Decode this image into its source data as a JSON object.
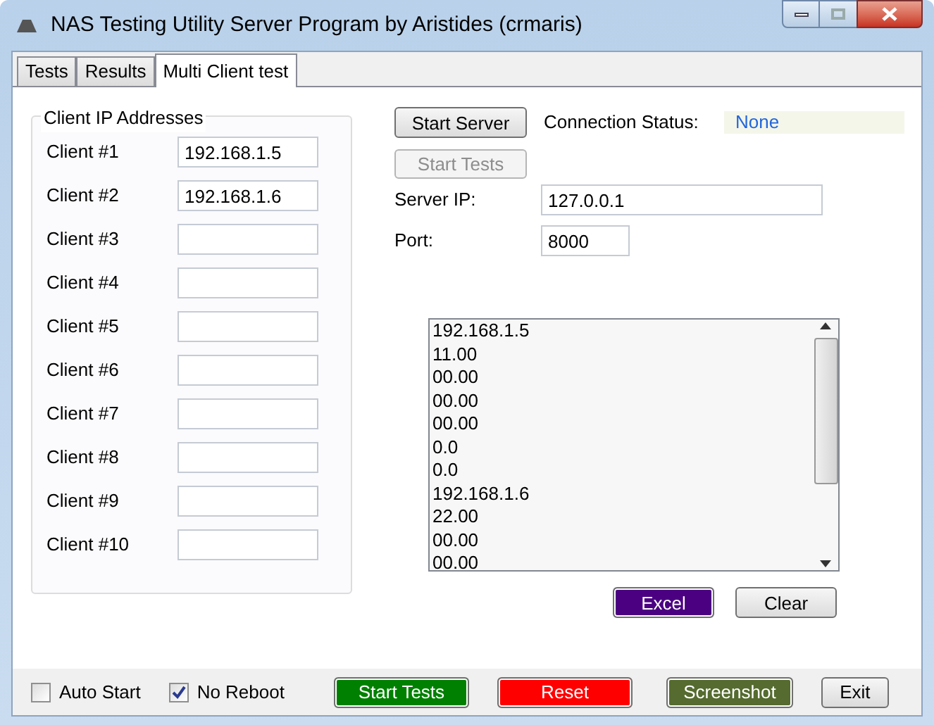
{
  "window": {
    "title": "NAS Testing Utility Server Program by Aristides (crmaris)"
  },
  "tabs": [
    {
      "label": "Tests",
      "selected": false
    },
    {
      "label": "Results",
      "selected": false
    },
    {
      "label": "Multi Client test",
      "selected": true
    }
  ],
  "client_group": {
    "title": "Client IP Addresses",
    "clients": [
      {
        "label": "Client #1",
        "value": "192.168.1.5"
      },
      {
        "label": "Client #2",
        "value": "192.168.1.6"
      },
      {
        "label": "Client #3"
      },
      {
        "label": "Client #4"
      },
      {
        "label": "Client #5"
      },
      {
        "label": "Client #6"
      },
      {
        "label": "Client #7"
      },
      {
        "label": "Client #8"
      },
      {
        "label": "Client #9"
      },
      {
        "label": "Client #10"
      }
    ]
  },
  "server": {
    "start_server": {
      "label": "Start Server"
    },
    "start_tests": {
      "label": "Start Tests",
      "disabled": true
    },
    "status_label": "Connection Status:",
    "status_value": "None",
    "ip_label": "Server IP:",
    "ip_value": "127.0.0.1",
    "port_label": "Port:",
    "port_value": "8000"
  },
  "log": [
    "192.168.1.5",
    "11.00",
    "00.00",
    "00.00",
    "00.00",
    "0.0",
    "0.0",
    "192.168.1.6",
    "22.00",
    "00.00",
    "00.00"
  ],
  "log_buttons": [
    {
      "label": "Excel",
      "color": "#4b0082"
    },
    {
      "label": "Clear"
    }
  ],
  "checkboxes": [
    {
      "label": "Auto Start",
      "checked": false
    },
    {
      "label": "No Reboot",
      "checked": true
    }
  ],
  "bottom_buttons": [
    {
      "label": "Start Tests",
      "color": "#008000"
    },
    {
      "label": "Reset",
      "color": "#ff0000"
    },
    {
      "label": "Screenshot",
      "color": "#556b2f"
    },
    {
      "label": "Exit"
    }
  ]
}
